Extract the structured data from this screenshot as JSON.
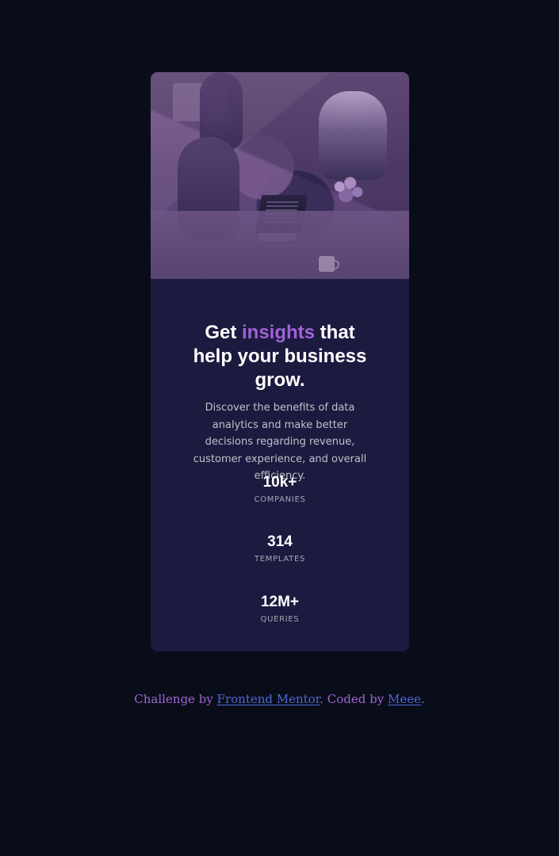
{
  "card": {
    "title_prefix": "Get ",
    "title_accent": "insights",
    "title_suffix": " that help your business grow.",
    "description": "Discover the benefits of data analytics and make better decisions regarding revenue, customer experience, and overall efficiency.",
    "stats": [
      {
        "value": "10k+",
        "label": "COMPANIES"
      },
      {
        "value": "314",
        "label": "TEMPLATES"
      },
      {
        "value": "12M+",
        "label": "QUERIES"
      }
    ]
  },
  "footer": {
    "prefix": "Challenge by ",
    "mentor_link": "Frontend Mentor",
    "middle": ". Coded by ",
    "author_link": "Meee",
    "suffix": "."
  },
  "colors": {
    "background": "#090d19",
    "card": "#1c1a3f",
    "accent": "#a063d6",
    "link": "#5067d6"
  },
  "icons": {
    "hero_image": "team-photo"
  }
}
